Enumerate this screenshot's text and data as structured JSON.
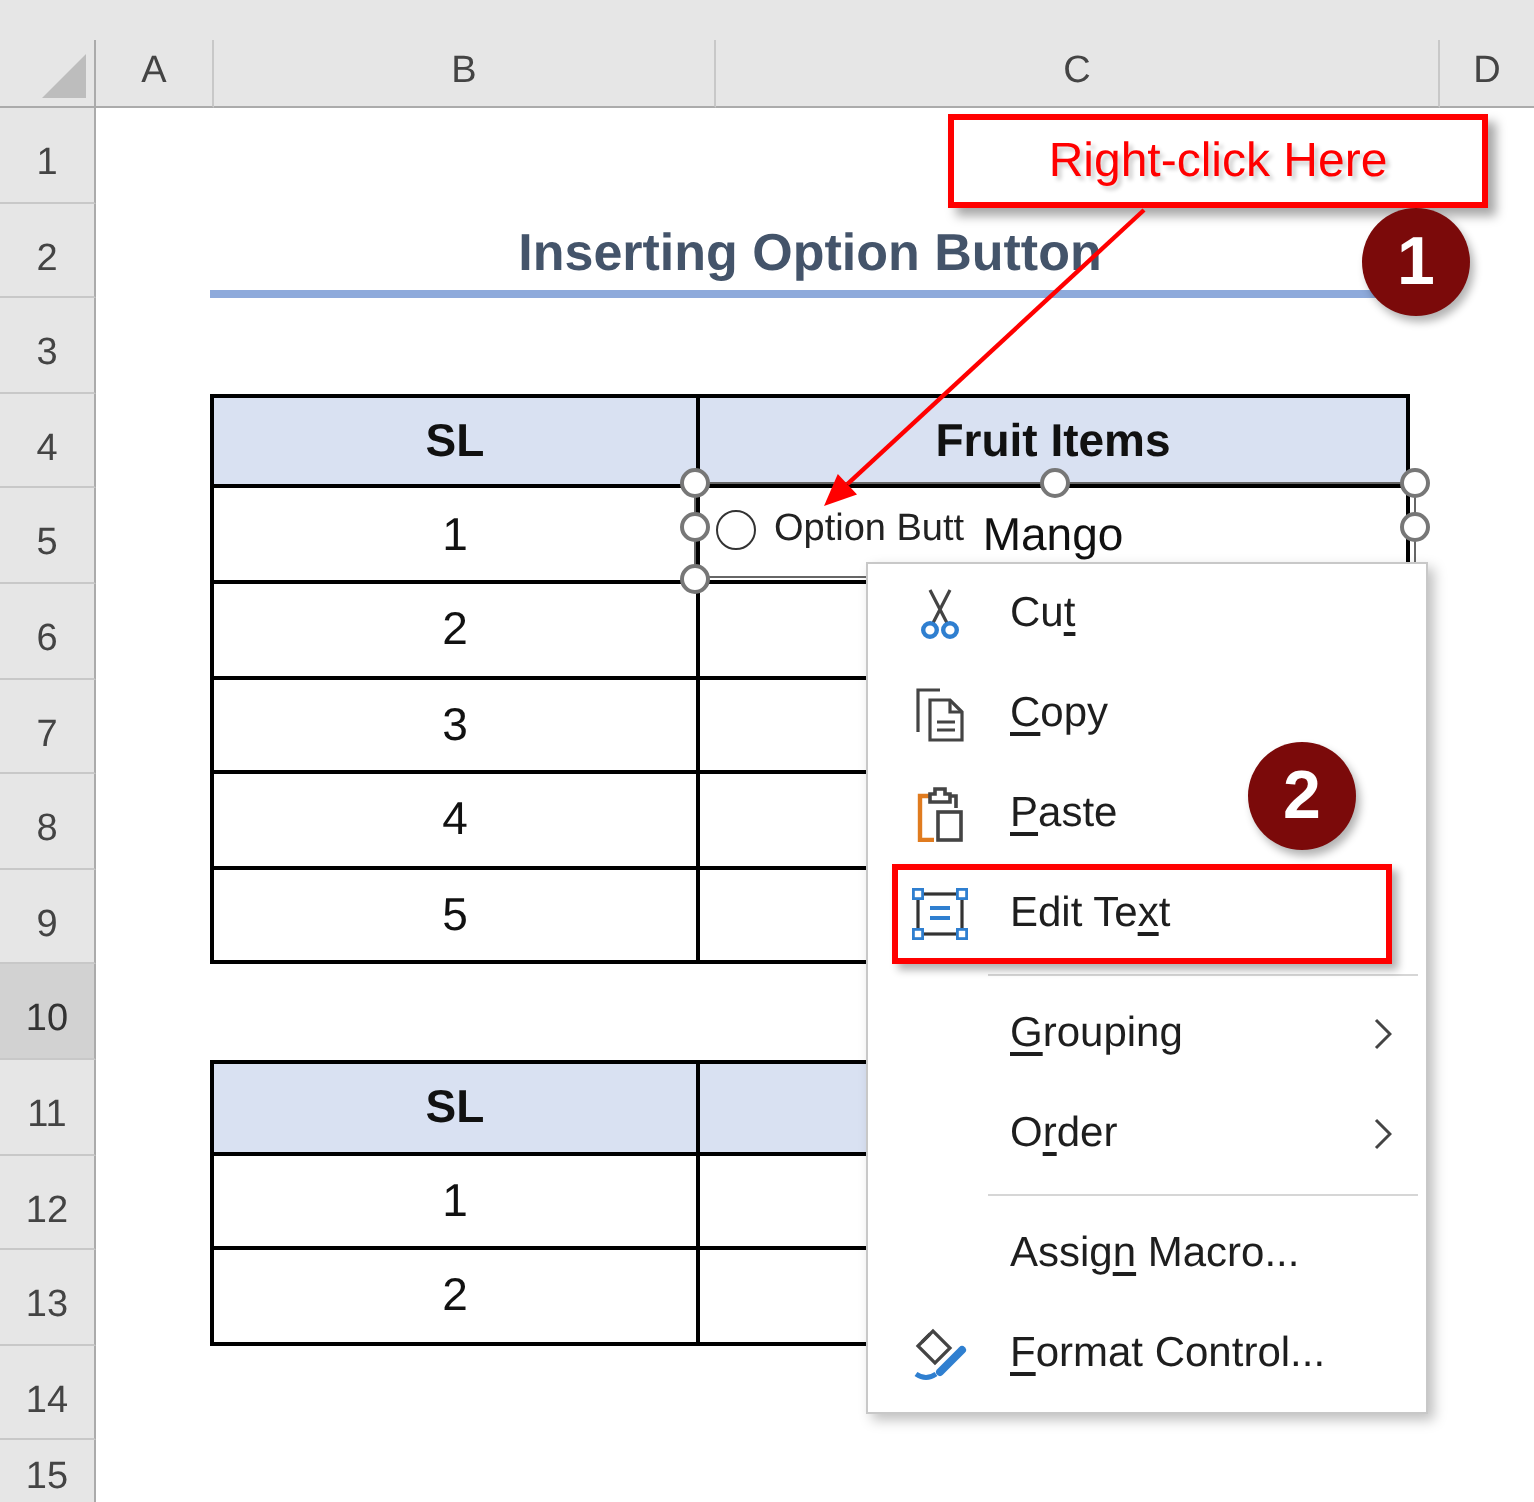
{
  "column_headers": [
    {
      "label": "A",
      "selected": false
    },
    {
      "label": "B",
      "selected": false
    },
    {
      "label": "C",
      "selected": false
    },
    {
      "label": "D",
      "selected": false
    }
  ],
  "row_headers": [
    {
      "label": "1",
      "selected": false
    },
    {
      "label": "2",
      "selected": false
    },
    {
      "label": "3",
      "selected": false
    },
    {
      "label": "4",
      "selected": false
    },
    {
      "label": "5",
      "selected": false
    },
    {
      "label": "6",
      "selected": false
    },
    {
      "label": "7",
      "selected": false
    },
    {
      "label": "8",
      "selected": false
    },
    {
      "label": "9",
      "selected": false
    },
    {
      "label": "10",
      "selected": true
    },
    {
      "label": "11",
      "selected": false
    },
    {
      "label": "12",
      "selected": false
    },
    {
      "label": "13",
      "selected": false
    },
    {
      "label": "14",
      "selected": false
    },
    {
      "label": "15",
      "selected": false
    }
  ],
  "title": "Inserting Option Button",
  "tables": [
    {
      "columns": [
        "SL",
        "Fruit Items"
      ],
      "rows": [
        [
          "1",
          "Mango"
        ],
        [
          "2"
        ],
        [
          "3"
        ],
        [
          "4"
        ],
        [
          "5"
        ]
      ]
    },
    {
      "columns": [
        "SL",
        null
      ],
      "rows": [
        [
          "1"
        ],
        [
          "2"
        ]
      ]
    }
  ],
  "option_button": {
    "label": "Option Butt",
    "checked": false,
    "selected": true
  },
  "callout": {
    "text": "Right-click Here"
  },
  "step_badges": [
    "1",
    "2"
  ],
  "context_menu": {
    "items": [
      {
        "kind": "command",
        "segments": [
          {
            "text": "Cu",
            "underlined": false
          },
          {
            "text": "t",
            "underlined": true
          }
        ],
        "submenu": false,
        "highlighted": false
      },
      {
        "kind": "command",
        "segments": [
          {
            "text": "C",
            "underlined": true
          },
          {
            "text": "opy",
            "underlined": false
          }
        ],
        "submenu": false,
        "highlighted": false
      },
      {
        "kind": "command",
        "segments": [
          {
            "text": "P",
            "underlined": true
          },
          {
            "text": "aste",
            "underlined": false
          }
        ],
        "submenu": false,
        "highlighted": false
      },
      {
        "kind": "command",
        "segments": [
          {
            "text": "Edit Te",
            "underlined": false
          },
          {
            "text": "x",
            "underlined": true
          },
          {
            "text": "t",
            "underlined": false
          }
        ],
        "submenu": false,
        "highlighted": true
      },
      {
        "kind": "separator"
      },
      {
        "kind": "command",
        "segments": [
          {
            "text": "G",
            "underlined": true
          },
          {
            "text": "rouping",
            "underlined": false
          }
        ],
        "submenu": true,
        "highlighted": false
      },
      {
        "kind": "command",
        "segments": [
          {
            "text": "O",
            "underlined": false
          },
          {
            "text": "r",
            "underlined": true
          },
          {
            "text": "der",
            "underlined": false
          }
        ],
        "submenu": true,
        "highlighted": false
      },
      {
        "kind": "separator"
      },
      {
        "kind": "command",
        "segments": [
          {
            "text": "Assig",
            "underlined": false
          },
          {
            "text": "n",
            "underlined": true
          },
          {
            "text": " Macro...",
            "underlined": false
          }
        ],
        "submenu": false,
        "highlighted": false
      },
      {
        "kind": "command",
        "segments": [
          {
            "text": "F",
            "underlined": true
          },
          {
            "text": "ormat Control...",
            "underlined": false
          }
        ],
        "submenu": false,
        "highlighted": false
      }
    ]
  }
}
